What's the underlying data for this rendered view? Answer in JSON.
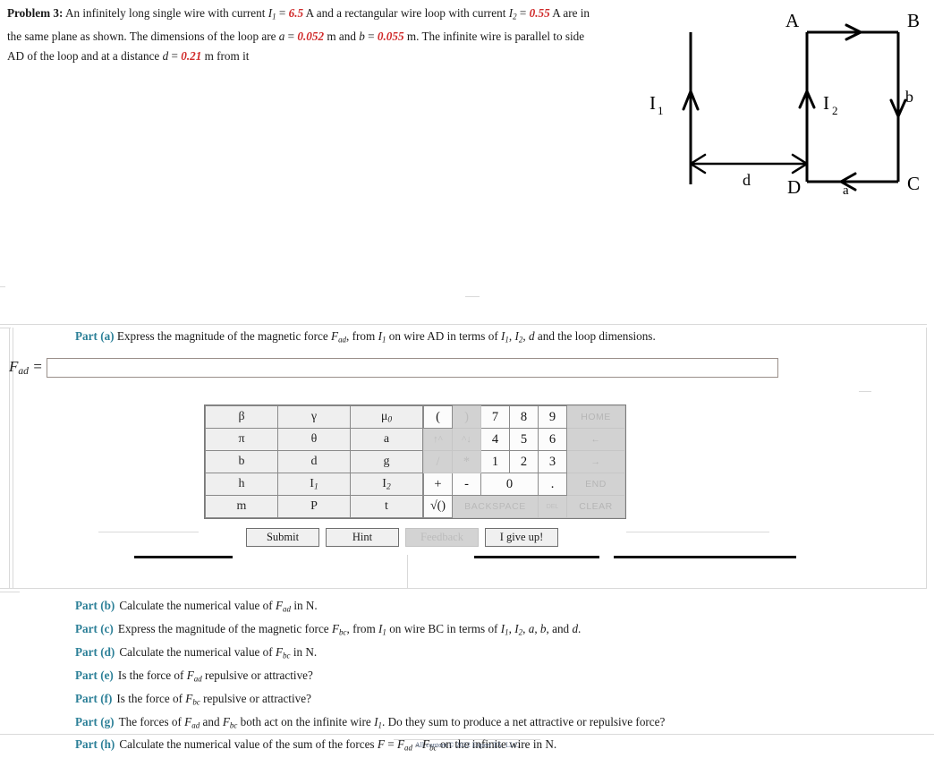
{
  "problem": {
    "title": "Problem 3:",
    "text_parts": [
      {
        "t": "An infinitely long single wire with current "
      },
      {
        "t": "I",
        "style": "italic"
      },
      {
        "t": "1",
        "style": "sub"
      },
      {
        "t": " = "
      },
      {
        "t": "6.5",
        "style": "value"
      },
      {
        "t": " A and a rectangular wire loop with current "
      },
      {
        "t": "I",
        "style": "italic"
      },
      {
        "t": "2",
        "style": "sub"
      },
      {
        "t": " = "
      },
      {
        "t": "0.55",
        "style": "value"
      },
      {
        "t": " A are in the same plane as shown. The dimensions of the loop are "
      },
      {
        "t": "a",
        "style": "italic"
      },
      {
        "t": " = "
      },
      {
        "t": "0.052",
        "style": "value"
      },
      {
        "t": " m and "
      },
      {
        "t": "b",
        "style": "italic"
      },
      {
        "t": " = "
      },
      {
        "t": "0.055",
        "style": "value"
      },
      {
        "t": " m. The infinite wire is parallel to side AD of the loop and at a distance "
      },
      {
        "t": "d",
        "style": "italic"
      },
      {
        "t": " = "
      },
      {
        "t": "0.21",
        "style": "value"
      },
      {
        "t": " m from it"
      }
    ],
    "given": {
      "I1": "6.5",
      "I1_unit": "A",
      "I2": "0.55",
      "I2_unit": "A",
      "a": "0.052",
      "a_unit": "m",
      "b": "0.055",
      "b_unit": "m",
      "d": "0.21",
      "d_unit": "m"
    }
  },
  "figure": {
    "labels": {
      "wire_current": "I",
      "wire_current_sub": "1",
      "loop_current": "I",
      "loop_current_sub": "2",
      "corner_a": "A",
      "corner_b": "B",
      "corner_c": "C",
      "corner_d": "D",
      "side_a": "a",
      "side_b": "b",
      "distance": "d"
    }
  },
  "part_a": {
    "label": "Part (a)",
    "prompt_segments": [
      {
        "t": "Express the magnitude of the magnetic force "
      },
      {
        "t": "F",
        "style": "italic"
      },
      {
        "t": "ad",
        "style": "sub"
      },
      {
        "t": ", from "
      },
      {
        "t": "I",
        "style": "italic"
      },
      {
        "t": "1",
        "style": "sub"
      },
      {
        "t": " on wire AD in terms of "
      },
      {
        "t": "I",
        "style": "italic"
      },
      {
        "t": "1",
        "style": "sub"
      },
      {
        "t": ", "
      },
      {
        "t": "I",
        "style": "italic"
      },
      {
        "t": "2",
        "style": "sub"
      },
      {
        "t": ", "
      },
      {
        "t": "d",
        "style": "italic"
      },
      {
        "t": " and the loop dimensions."
      }
    ],
    "answer_label": "F",
    "answer_label_sub": "ad",
    "answer_equals": " =",
    "answer_value": "",
    "answer_placeholder": ""
  },
  "keypad": {
    "symbols": [
      [
        "β",
        "γ",
        "μ0"
      ],
      [
        "π",
        "θ",
        "a"
      ],
      [
        "b",
        "d",
        "g"
      ],
      [
        "h",
        "I1",
        "I2"
      ],
      [
        "m",
        "P",
        "t"
      ]
    ],
    "symbol_cells": [
      {
        "label": "β",
        "name": "beta"
      },
      {
        "label": "γ",
        "name": "gamma"
      },
      {
        "label": "μ",
        "sub": "0",
        "name": "mu-zero"
      },
      {
        "label": "π",
        "name": "pi"
      },
      {
        "label": "θ",
        "name": "theta"
      },
      {
        "label": "a",
        "name": "a"
      },
      {
        "label": "b",
        "name": "b"
      },
      {
        "label": "d",
        "name": "d"
      },
      {
        "label": "g",
        "name": "g"
      },
      {
        "label": "h",
        "name": "h"
      },
      {
        "label": "I",
        "sub": "1",
        "name": "i-one"
      },
      {
        "label": "I",
        "sub": "2",
        "name": "i-two"
      },
      {
        "label": "m",
        "name": "m"
      },
      {
        "label": "P",
        "name": "p"
      },
      {
        "label": "t",
        "name": "t"
      }
    ],
    "numeric": {
      "open_paren": "(",
      "close_paren": ")",
      "seven": "7",
      "eight": "8",
      "nine": "9",
      "home": "HOME",
      "superscript_up": "↑^",
      "superscript_down": "^↓",
      "four": "4",
      "five": "5",
      "six": "6",
      "left_arrow": "←",
      "divide": "/",
      "multiply": "*",
      "one": "1",
      "two": "2",
      "three": "3",
      "right_arrow": "→",
      "plus": "+",
      "minus": "-",
      "zero": "0",
      "decimal": ".",
      "end": "END",
      "sqrt": "√()",
      "backspace": "BACKSPACE",
      "del": "DEL",
      "clear": "CLEAR"
    }
  },
  "actions": {
    "submit": "Submit",
    "hint": "Hint",
    "feedback": "Feedback",
    "give_up": "I give up!"
  },
  "parts": [
    {
      "label": "Part (b)",
      "segments": [
        {
          "t": "Calculate the numerical value of "
        },
        {
          "t": "F",
          "style": "italic"
        },
        {
          "t": "ad",
          "style": "sub"
        },
        {
          "t": " in N."
        }
      ]
    },
    {
      "label": "Part (c)",
      "segments": [
        {
          "t": "Express the magnitude of the magnetic force "
        },
        {
          "t": "F",
          "style": "italic"
        },
        {
          "t": "bc",
          "style": "sub"
        },
        {
          "t": ", from "
        },
        {
          "t": "I",
          "style": "italic"
        },
        {
          "t": "1",
          "style": "sub"
        },
        {
          "t": " on wire BC in terms of "
        },
        {
          "t": "I",
          "style": "italic"
        },
        {
          "t": "1",
          "style": "sub"
        },
        {
          "t": ", "
        },
        {
          "t": "I",
          "style": "italic"
        },
        {
          "t": "2",
          "style": "sub"
        },
        {
          "t": ", "
        },
        {
          "t": "a",
          "style": "italic"
        },
        {
          "t": ", "
        },
        {
          "t": "b",
          "style": "italic"
        },
        {
          "t": ", and "
        },
        {
          "t": "d",
          "style": "italic"
        },
        {
          "t": "."
        }
      ]
    },
    {
      "label": "Part (d)",
      "segments": [
        {
          "t": "Calculate the numerical value of "
        },
        {
          "t": "F",
          "style": "italic"
        },
        {
          "t": "bc",
          "style": "sub"
        },
        {
          "t": " in N."
        }
      ]
    },
    {
      "label": "Part (e)",
      "segments": [
        {
          "t": "Is the force of "
        },
        {
          "t": "F",
          "style": "italic"
        },
        {
          "t": "ad",
          "style": "sub"
        },
        {
          "t": " repulsive or attractive?"
        }
      ]
    },
    {
      "label": "Part (f)",
      "segments": [
        {
          "t": "Is the force of "
        },
        {
          "t": "F",
          "style": "italic"
        },
        {
          "t": "bc",
          "style": "sub"
        },
        {
          "t": " repulsive or attractive?"
        }
      ]
    },
    {
      "label": "Part (g)",
      "segments": [
        {
          "t": "The forces of "
        },
        {
          "t": "F",
          "style": "italic"
        },
        {
          "t": "ad",
          "style": "sub"
        },
        {
          "t": " and "
        },
        {
          "t": "F",
          "style": "italic"
        },
        {
          "t": "bc",
          "style": "sub"
        },
        {
          "t": " both act on the infinite wire "
        },
        {
          "t": "I",
          "style": "italic"
        },
        {
          "t": "1",
          "style": "sub"
        },
        {
          "t": ". Do they sum to produce a net attractive or repulsive force?"
        }
      ]
    },
    {
      "label": "Part (h)",
      "segments": [
        {
          "t": "Calculate the numerical value of the sum of the forces "
        },
        {
          "t": "F",
          "style": "italic"
        },
        {
          "t": " = "
        },
        {
          "t": "F",
          "style": "italic"
        },
        {
          "t": "ad",
          "style": "sub"
        },
        {
          "t": " - "
        },
        {
          "t": "F",
          "style": "italic"
        },
        {
          "t": "bc",
          "style": "sub"
        },
        {
          "t": " on the infinite wire in N."
        }
      ]
    }
  ],
  "footer": {
    "copyright": "All content © 2022 Expert TA, LLC"
  },
  "colors": {
    "value_red": "#d02b2b",
    "part_label_teal": "#2b7f97",
    "footer_blue": "#5b6b85",
    "keypad_active_bg": "#fcfcfc",
    "keypad_disabled_bg": "#d2d2d2"
  }
}
